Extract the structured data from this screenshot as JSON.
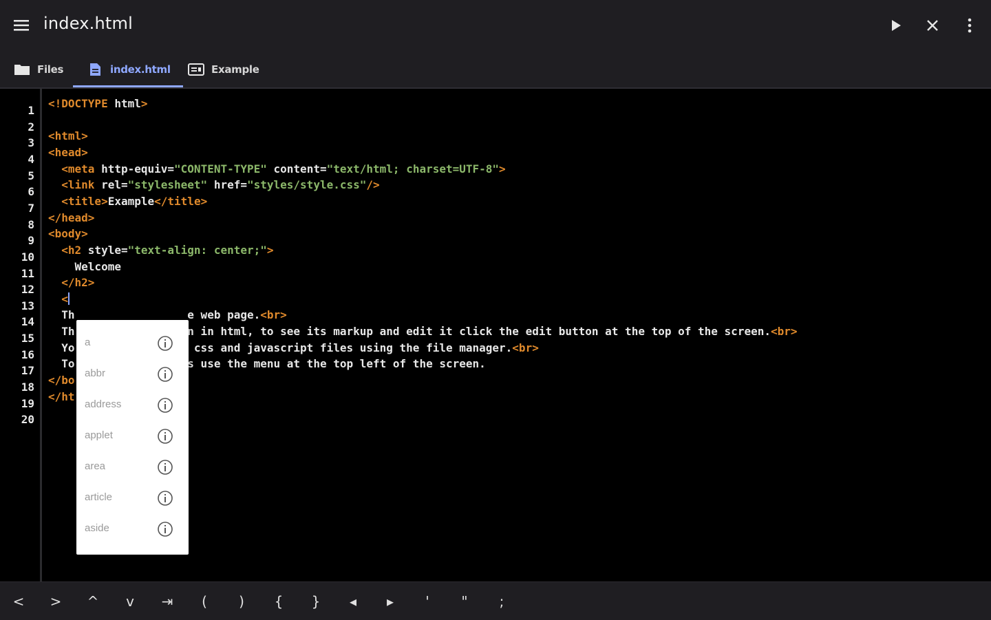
{
  "appbar": {
    "title": "index.html",
    "menu_icon": "hamburger-menu-icon",
    "actions": [
      "play-icon",
      "close-icon",
      "more-vert-icon"
    ]
  },
  "tabs": [
    {
      "label": "Files",
      "icon": "folder-icon",
      "active": false
    },
    {
      "label": "index.html",
      "icon": "file-icon",
      "active": true
    },
    {
      "label": "Example",
      "icon": "preview-icon",
      "active": false
    }
  ],
  "editor": {
    "line_numbers": [
      "1",
      "2",
      "3",
      "4",
      "5",
      "6",
      "7",
      "8",
      "9",
      "10",
      "11",
      "12",
      "13",
      "14",
      "15",
      "16",
      "17",
      "18",
      "19",
      "20"
    ],
    "lines": [
      [
        [
          "tag",
          "<!DOCTYPE "
        ],
        [
          "attr",
          "html"
        ],
        [
          "tag",
          ">"
        ]
      ],
      [],
      [
        [
          "tag",
          "<html>"
        ]
      ],
      [
        [
          "tag",
          "<head>"
        ]
      ],
      [
        [
          "txt",
          "  "
        ],
        [
          "tag",
          "<meta "
        ],
        [
          "attr",
          "http-equiv="
        ],
        [
          "str",
          "\"CONTENT-TYPE\""
        ],
        [
          "attr",
          " content="
        ],
        [
          "str",
          "\"text/html; charset=UTF-8\""
        ],
        [
          "tag",
          ">"
        ]
      ],
      [
        [
          "txt",
          "  "
        ],
        [
          "tag",
          "<link "
        ],
        [
          "attr",
          "rel="
        ],
        [
          "str",
          "\"stylesheet\""
        ],
        [
          "attr",
          " href="
        ],
        [
          "str",
          "\"styles/style.css\""
        ],
        [
          "tag",
          "/>"
        ]
      ],
      [
        [
          "txt",
          "  "
        ],
        [
          "tag",
          "<title>"
        ],
        [
          "txt",
          "Example"
        ],
        [
          "tag",
          "</title>"
        ]
      ],
      [
        [
          "tag",
          "</head>"
        ]
      ],
      [
        [
          "tag",
          "<body>"
        ]
      ],
      [
        [
          "txt",
          "  "
        ],
        [
          "tag",
          "<h2 "
        ],
        [
          "attr",
          "style="
        ],
        [
          "str",
          "\"text-align: center;\""
        ],
        [
          "tag",
          ">"
        ]
      ],
      [
        [
          "txt",
          "    Welcome"
        ]
      ],
      [
        [
          "txt",
          "  "
        ],
        [
          "tag",
          "</h2>"
        ]
      ],
      [
        [
          "txt",
          "  "
        ],
        [
          "tag",
          "<"
        ],
        [
          "cursor",
          ""
        ]
      ],
      [
        [
          "txt",
          "  Th                 e web page."
        ],
        [
          "tag",
          "<br>"
        ]
      ],
      [
        [
          "txt",
          "  Th                en in html, to see its markup and edit it click the edit button at the top of the screen."
        ],
        [
          "tag",
          "<br>"
        ]
      ],
      [
        [
          "txt",
          "  Yo                , css and javascript files using the file manager."
        ],
        [
          "tag",
          "<br>"
        ]
      ],
      [
        [
          "txt",
          "  To                es use the menu at the top left of the screen."
        ]
      ],
      [
        [
          "tag",
          "</bo"
        ]
      ],
      [
        [
          "tag",
          "</ht"
        ]
      ],
      []
    ]
  },
  "autocomplete": {
    "items": [
      "a",
      "abbr",
      "address",
      "applet",
      "area",
      "article",
      "aside"
    ],
    "info_icon": "info-circle-icon"
  },
  "keybar": {
    "keys": [
      "<",
      ">",
      "^",
      "v",
      "⇥",
      "(",
      ")",
      "{",
      "}",
      "◂",
      "▸",
      "'",
      "\"",
      ";"
    ],
    "icons": [
      "chevron-left-icon",
      "chevron-right-icon",
      "chevron-up-icon",
      "chevron-down-icon",
      "tab-key-icon",
      "open-paren-key",
      "close-paren-key",
      "open-brace-key",
      "close-brace-key",
      "caret-left-key",
      "caret-right-key",
      "single-quote-key",
      "double-quote-key",
      "semicolon-key"
    ]
  }
}
